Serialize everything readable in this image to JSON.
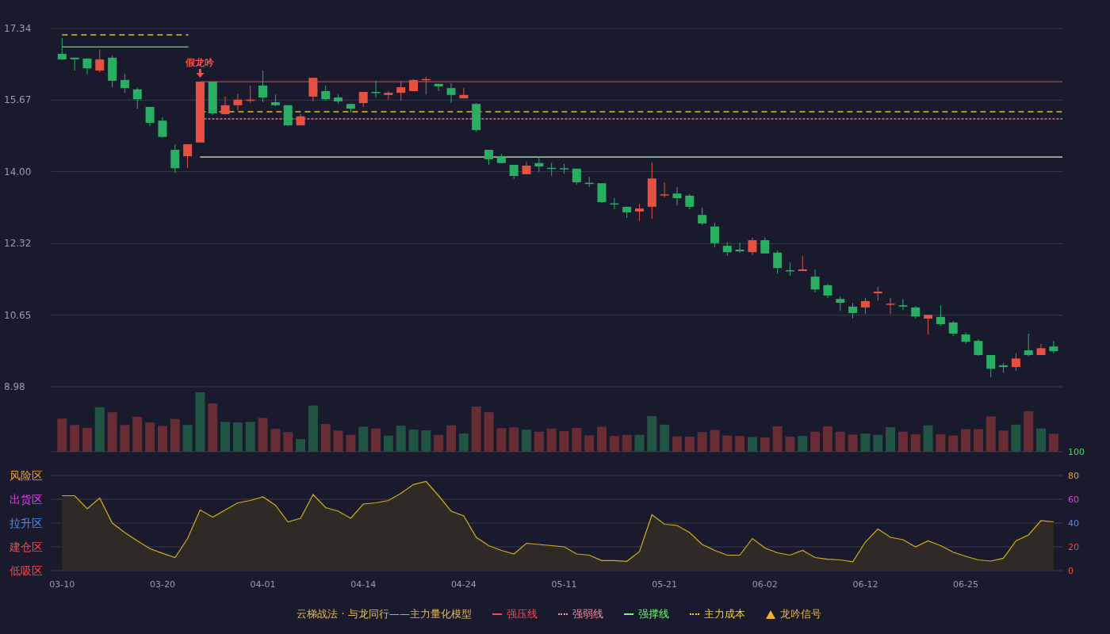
{
  "price_chart": {
    "chart_data": {
      "type": "candlestick",
      "grid": true,
      "ylim": [
        8.98,
        17.34
      ],
      "yticks": [
        {
          "value": 17.34,
          "label": "17.34"
        },
        {
          "value": 15.67,
          "label": "15.67"
        },
        {
          "value": 14.0,
          "label": "14.00"
        },
        {
          "value": 12.32,
          "label": "12.32"
        },
        {
          "value": 10.65,
          "label": "10.65"
        },
        {
          "value": 8.98,
          "label": "8.98"
        }
      ],
      "ohlc": [
        [
          16.75,
          17.12,
          16.62,
          16.62
        ],
        [
          16.66,
          16.66,
          16.36,
          16.62
        ],
        [
          16.64,
          16.64,
          16.27,
          16.41
        ],
        [
          16.36,
          16.84,
          16.32,
          16.62
        ],
        [
          16.66,
          16.71,
          15.97,
          16.12
        ],
        [
          16.14,
          16.29,
          15.84,
          15.95
        ],
        [
          15.92,
          15.95,
          15.47,
          15.69
        ],
        [
          15.51,
          15.51,
          15.06,
          15.14
        ],
        [
          15.19,
          15.27,
          14.79,
          14.81
        ],
        [
          14.51,
          14.64,
          13.97,
          14.08
        ],
        [
          14.36,
          14.64,
          14.08,
          14.64
        ],
        [
          14.68,
          16.1,
          14.68,
          16.1
        ],
        [
          16.1,
          16.1,
          15.32,
          15.36
        ],
        [
          15.34,
          15.75,
          15.34,
          15.55
        ],
        [
          15.55,
          15.82,
          15.43,
          15.68
        ],
        [
          15.66,
          16.01,
          15.6,
          15.68
        ],
        [
          16.01,
          16.36,
          15.62,
          15.73
        ],
        [
          15.62,
          15.8,
          15.53,
          15.55
        ],
        [
          15.55,
          15.55,
          15.06,
          15.08
        ],
        [
          15.08,
          15.34,
          15.08,
          15.29
        ],
        [
          15.75,
          16.19,
          15.64,
          16.19
        ],
        [
          15.88,
          16.01,
          15.66,
          15.69
        ],
        [
          15.73,
          15.8,
          15.58,
          15.64
        ],
        [
          15.58,
          15.58,
          15.38,
          15.47
        ],
        [
          15.6,
          15.86,
          15.51,
          15.86
        ],
        [
          15.86,
          16.12,
          15.73,
          15.84
        ],
        [
          15.79,
          15.88,
          15.68,
          15.84
        ],
        [
          15.84,
          16.12,
          15.66,
          15.97
        ],
        [
          15.88,
          16.16,
          15.88,
          16.14
        ],
        [
          16.14,
          16.21,
          15.8,
          16.16
        ],
        [
          16.05,
          16.05,
          15.88,
          15.99
        ],
        [
          15.95,
          16.06,
          15.6,
          15.79
        ],
        [
          15.71,
          15.95,
          15.71,
          15.79
        ],
        [
          15.58,
          15.6,
          14.93,
          14.97
        ],
        [
          14.51,
          14.51,
          14.16,
          14.29
        ],
        [
          14.34,
          14.42,
          14.2,
          14.2
        ],
        [
          14.16,
          14.16,
          13.83,
          13.9
        ],
        [
          13.94,
          14.23,
          13.94,
          14.14
        ],
        [
          14.2,
          14.34,
          13.99,
          14.12
        ],
        [
          14.09,
          14.21,
          13.9,
          14.08
        ],
        [
          14.08,
          14.18,
          13.95,
          14.07
        ],
        [
          14.07,
          14.07,
          13.7,
          13.75
        ],
        [
          13.74,
          13.88,
          13.64,
          13.73
        ],
        [
          13.73,
          13.73,
          13.27,
          13.29
        ],
        [
          13.26,
          13.38,
          13.12,
          13.25
        ],
        [
          13.18,
          13.18,
          12.92,
          13.05
        ],
        [
          13.07,
          13.25,
          12.85,
          13.14
        ],
        [
          13.18,
          14.21,
          12.9,
          13.84
        ],
        [
          13.46,
          13.75,
          13.4,
          13.47
        ],
        [
          13.49,
          13.64,
          13.21,
          13.38
        ],
        [
          13.44,
          13.47,
          13.12,
          13.18
        ],
        [
          12.99,
          13.16,
          12.75,
          12.79
        ],
        [
          12.72,
          12.81,
          12.23,
          12.33
        ],
        [
          12.27,
          12.36,
          12.03,
          12.12
        ],
        [
          12.18,
          12.34,
          12.11,
          12.14
        ],
        [
          12.12,
          12.46,
          12.05,
          12.4
        ],
        [
          12.4,
          12.46,
          12.09,
          12.09
        ],
        [
          12.11,
          12.16,
          11.62,
          11.75
        ],
        [
          11.7,
          11.88,
          11.57,
          11.68
        ],
        [
          11.68,
          12.03,
          11.68,
          11.72
        ],
        [
          11.55,
          11.72,
          11.18,
          11.25
        ],
        [
          11.35,
          11.38,
          11.05,
          11.11
        ],
        [
          11.03,
          11.09,
          10.75,
          10.94
        ],
        [
          10.85,
          10.94,
          10.57,
          10.7
        ],
        [
          10.83,
          11.05,
          10.68,
          10.98
        ],
        [
          11.16,
          11.31,
          10.99,
          11.2
        ],
        [
          10.9,
          11.05,
          10.68,
          10.92
        ],
        [
          10.88,
          11.03,
          10.77,
          10.85
        ],
        [
          10.83,
          10.86,
          10.57,
          10.62
        ],
        [
          10.57,
          10.66,
          10.2,
          10.66
        ],
        [
          10.61,
          10.88,
          10.4,
          10.44
        ],
        [
          10.48,
          10.51,
          10.16,
          10.22
        ],
        [
          10.2,
          10.25,
          9.98,
          10.03
        ],
        [
          10.05,
          10.09,
          9.7,
          9.72
        ],
        [
          9.72,
          9.72,
          9.2,
          9.4
        ],
        [
          9.48,
          9.53,
          9.31,
          9.44
        ],
        [
          9.44,
          9.76,
          9.35,
          9.64
        ],
        [
          9.83,
          10.22,
          9.68,
          9.72
        ],
        [
          9.72,
          9.98,
          9.72,
          9.88
        ],
        [
          9.92,
          10.05,
          9.76,
          9.81
        ]
      ],
      "annotations": [
        "假龙吟"
      ],
      "ref_lines": [
        {
          "axis": "y",
          "value": 17.19
        },
        {
          "axis": "y",
          "value": 16.91
        },
        {
          "axis": "y",
          "value": 16.1
        },
        {
          "axis": "y",
          "value": 15.4
        },
        {
          "axis": "y",
          "value": 15.23
        },
        {
          "axis": "y",
          "value": 14.34
        }
      ]
    }
  },
  "indicator_chart": {
    "zones": [
      {
        "label": "风险区",
        "color": "#f0a030"
      },
      {
        "label": "出货区",
        "color": "#e040e8"
      },
      {
        "label": "拉升区",
        "color": "#4a8cff"
      },
      {
        "label": "建仓区",
        "color": "#ff4545"
      },
      {
        "label": "低吸区",
        "color": "#ff4545"
      }
    ],
    "axis_labels": [
      {
        "label": "100",
        "color": "#3ddc5a"
      },
      {
        "label": "80",
        "color": "#f0a030"
      },
      {
        "label": "60",
        "color": "#e040e8"
      },
      {
        "label": "40",
        "color": "#4a8cff"
      },
      {
        "label": "20",
        "color": "#ff4545"
      },
      {
        "label": "0",
        "color": "#ff4545"
      }
    ],
    "chart_data": {
      "type": "area",
      "grid": true,
      "ylim": [
        0,
        100
      ],
      "yticks": [
        100,
        80,
        60,
        40,
        20,
        0
      ],
      "categories": [
        "03-10",
        null,
        null,
        null,
        null,
        null,
        null,
        null,
        "03-20",
        null,
        null,
        null,
        null,
        null,
        null,
        null,
        "04-01",
        null,
        null,
        null,
        null,
        null,
        null,
        null,
        "04-14",
        null,
        null,
        null,
        null,
        null,
        null,
        null,
        "04-24",
        null,
        null,
        null,
        null,
        null,
        null,
        null,
        "05-11",
        null,
        null,
        null,
        null,
        null,
        null,
        null,
        "05-21",
        null,
        null,
        null,
        null,
        null,
        null,
        null,
        "06-02",
        null,
        null,
        null,
        null,
        null,
        null,
        null,
        "06-12",
        null,
        null,
        null,
        null,
        null,
        null,
        null,
        "06-25",
        null,
        null,
        null,
        null,
        null,
        null,
        null
      ],
      "series": [
        {
          "color": "#d4b012",
          "values": [
            63,
            63,
            52,
            61,
            40,
            32,
            25,
            18.5,
            14.6,
            11,
            27,
            51,
            45,
            51,
            57,
            59,
            62,
            55,
            41,
            44,
            64,
            53,
            50,
            44,
            56,
            57,
            59,
            65,
            72.5,
            75,
            63,
            50,
            46,
            28,
            21,
            17,
            14,
            23,
            22,
            21,
            20,
            14,
            13,
            8.4,
            8.4,
            7.8,
            16,
            47,
            39,
            38,
            32,
            22,
            17,
            13,
            13,
            27,
            19,
            15,
            13,
            17,
            11,
            9.6,
            9,
            7.5,
            24,
            35,
            28,
            26,
            20,
            25,
            21,
            15.5,
            12,
            9,
            8,
            10.4,
            25,
            30,
            42,
            41
          ]
        }
      ]
    }
  },
  "legend": {
    "title": "云梯战法 · 与龙同行——主力量化模型",
    "items": [
      {
        "kind": "line",
        "label": "强压线",
        "color": "#ff4545"
      },
      {
        "kind": "dashed",
        "label": "强弱线",
        "color": "#ff8a9a"
      },
      {
        "kind": "line",
        "label": "强撑线",
        "color": "#66ff66"
      },
      {
        "kind": "dashed",
        "label": "主力成本",
        "color": "#ffd400"
      },
      {
        "kind": "triangle",
        "label": "龙吟信号",
        "color": "#f0b030"
      }
    ]
  }
}
